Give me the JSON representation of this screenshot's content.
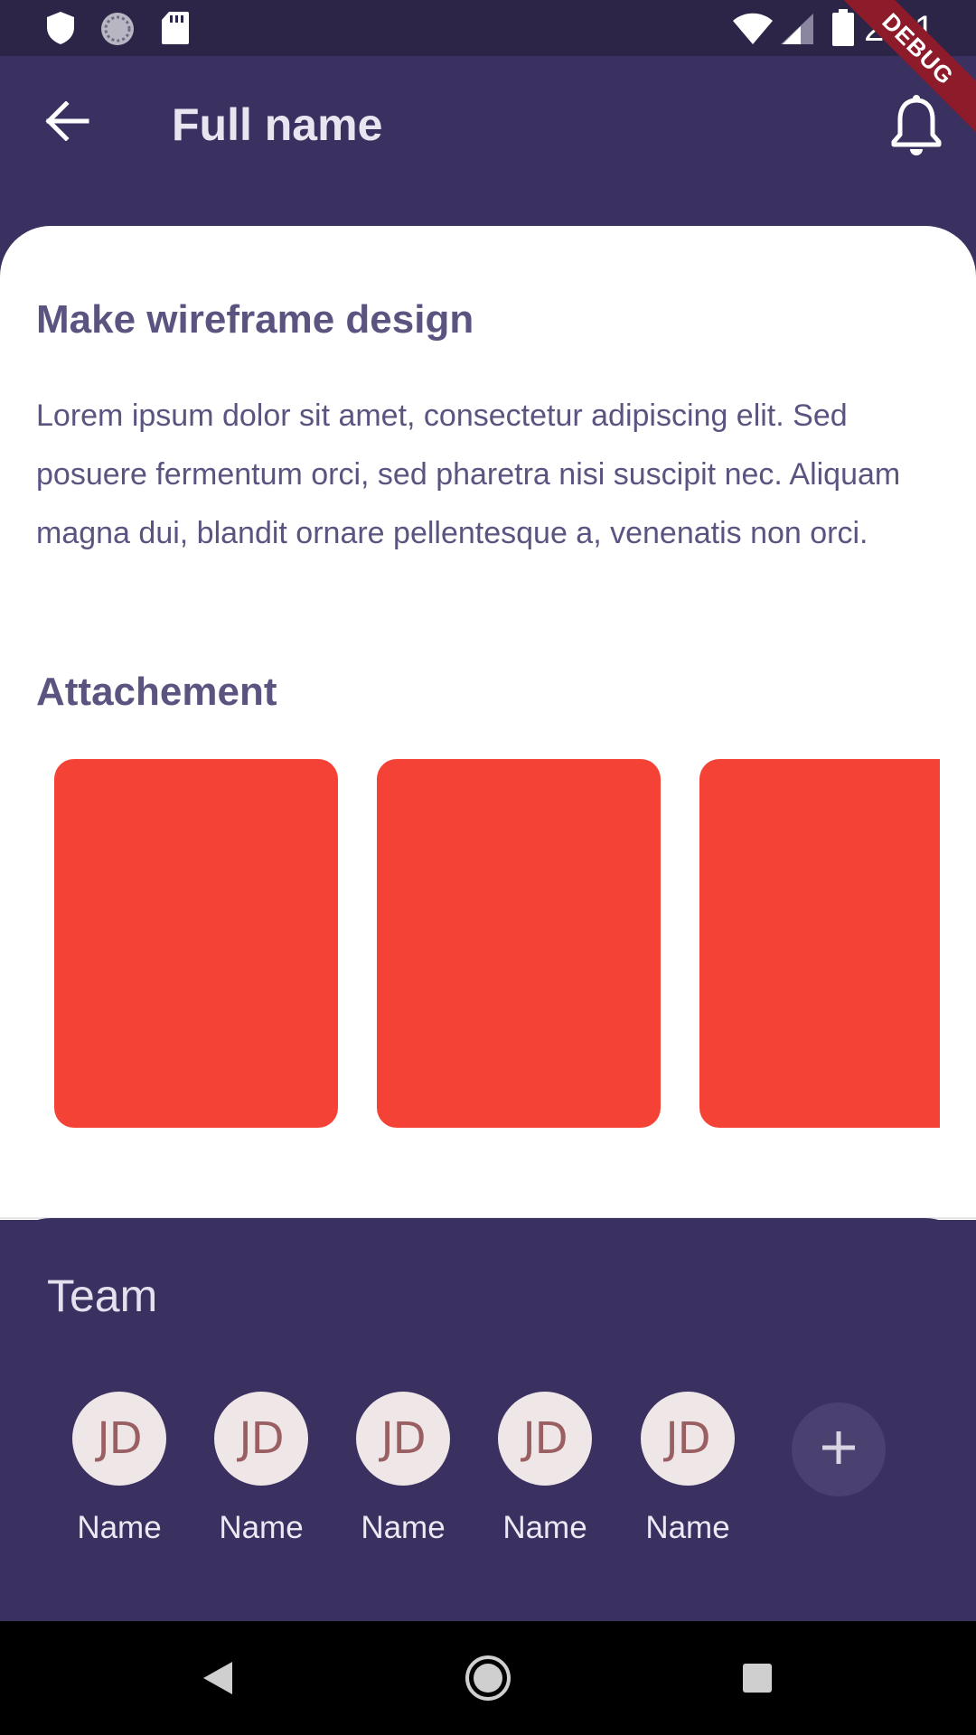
{
  "status_bar": {
    "time": "2:31",
    "left_icons": [
      "shield-icon",
      "sync-icon",
      "sd-card-icon"
    ],
    "right_icons": [
      "wifi-icon",
      "signal-icon",
      "battery-icon"
    ]
  },
  "debug_banner": "DEBUG",
  "app_bar": {
    "title": "Full name",
    "back_icon": "arrow-back-icon",
    "notification_icon": "bell-icon"
  },
  "task": {
    "title": "Make wireframe design",
    "description": "Lorem ipsum dolor sit amet, consectetur adipiscing elit. Sed posuere fermentum orci, sed pharetra nisi suscipit nec. Aliquam magna dui, blandit ornare pellentesque a, venenatis non orci."
  },
  "attachments": {
    "heading": "Attachement",
    "color": "#f44336",
    "count_visible": 3
  },
  "team": {
    "title": "Team",
    "members": [
      {
        "initials": "JD",
        "name": "Name"
      },
      {
        "initials": "JD",
        "name": "Name"
      },
      {
        "initials": "JD",
        "name": "Name"
      },
      {
        "initials": "JD",
        "name": "Name"
      },
      {
        "initials": "JD",
        "name": "Name"
      }
    ],
    "add_icon": "plus-icon"
  },
  "nav_bar": {
    "icons": [
      "nav-back-icon",
      "nav-home-icon",
      "nav-recents-icon"
    ]
  },
  "colors": {
    "primary": "#3b3160",
    "status_bar": "#2c2547",
    "text_muted": "#5b5480",
    "avatar_bg": "#efe7e7",
    "avatar_text": "#9a5f62"
  }
}
